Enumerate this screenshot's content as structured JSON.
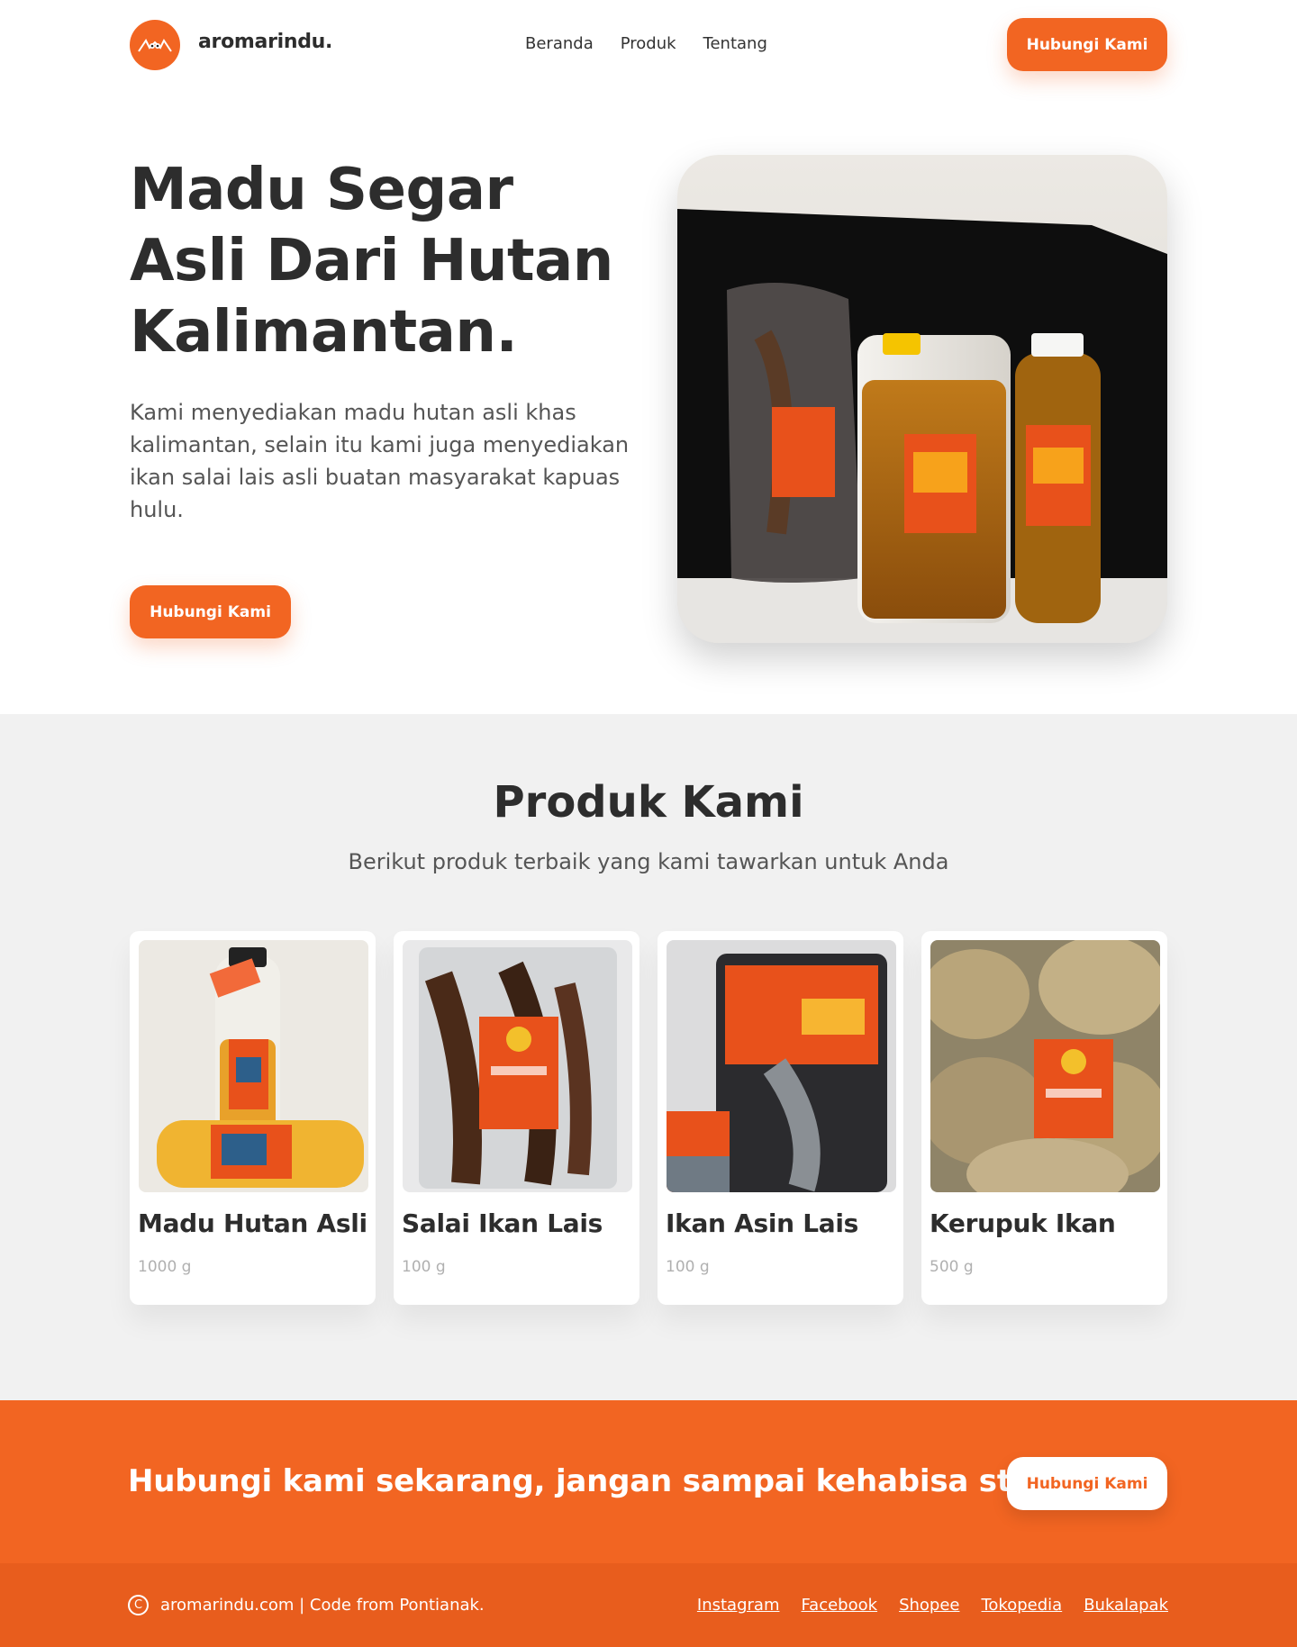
{
  "nav": {
    "brand": "aromarindu.",
    "logo_icon": "bee-face-logo-icon",
    "menu": [
      {
        "label": "Beranda"
      },
      {
        "label": "Produk"
      },
      {
        "label": "Tentang"
      }
    ],
    "cta_label": "Hubungi Kami"
  },
  "hero": {
    "title": "Madu Segar Asli Dari Hutan Kalimantan.",
    "description": "Kami menyediakan madu hutan asli khas kalimantan, selain itu kami juga menyediakan ikan salai lais asli buatan masyarakat kapuas hulu.",
    "cta_label": "Hubungi Kami",
    "image_alt": "honey-and-fish-products-photo"
  },
  "products": {
    "title": "Produk Kami",
    "subtitle": "Berikut produk terbaik yang kami tawarkan untuk Anda",
    "items": [
      {
        "name": "Madu Hutan Asli",
        "weight": "1000 g"
      },
      {
        "name": "Salai Ikan Lais",
        "weight": "100 g"
      },
      {
        "name": "Ikan Asin Lais",
        "weight": "100 g"
      },
      {
        "name": "Kerupuk Ikan",
        "weight": "500 g"
      }
    ]
  },
  "cta": {
    "text": "Hubungi kami sekarang, jangan sampai kehabisa stok.",
    "button_label": "Hubungi Kami"
  },
  "footer": {
    "copyright_icon": "copyright-icon",
    "text": "aromarindu.com | Code from Pontianak.",
    "links": [
      {
        "label": "Instagram"
      },
      {
        "label": "Facebook"
      },
      {
        "label": "Shopee"
      },
      {
        "label": "Tokopedia"
      },
      {
        "label": "Bukalapak"
      }
    ]
  },
  "colors": {
    "accent": "#f26522",
    "footer": "#e85d1d",
    "section_bg": "#f1f1f1",
    "text_dark": "#2d2d2d"
  }
}
